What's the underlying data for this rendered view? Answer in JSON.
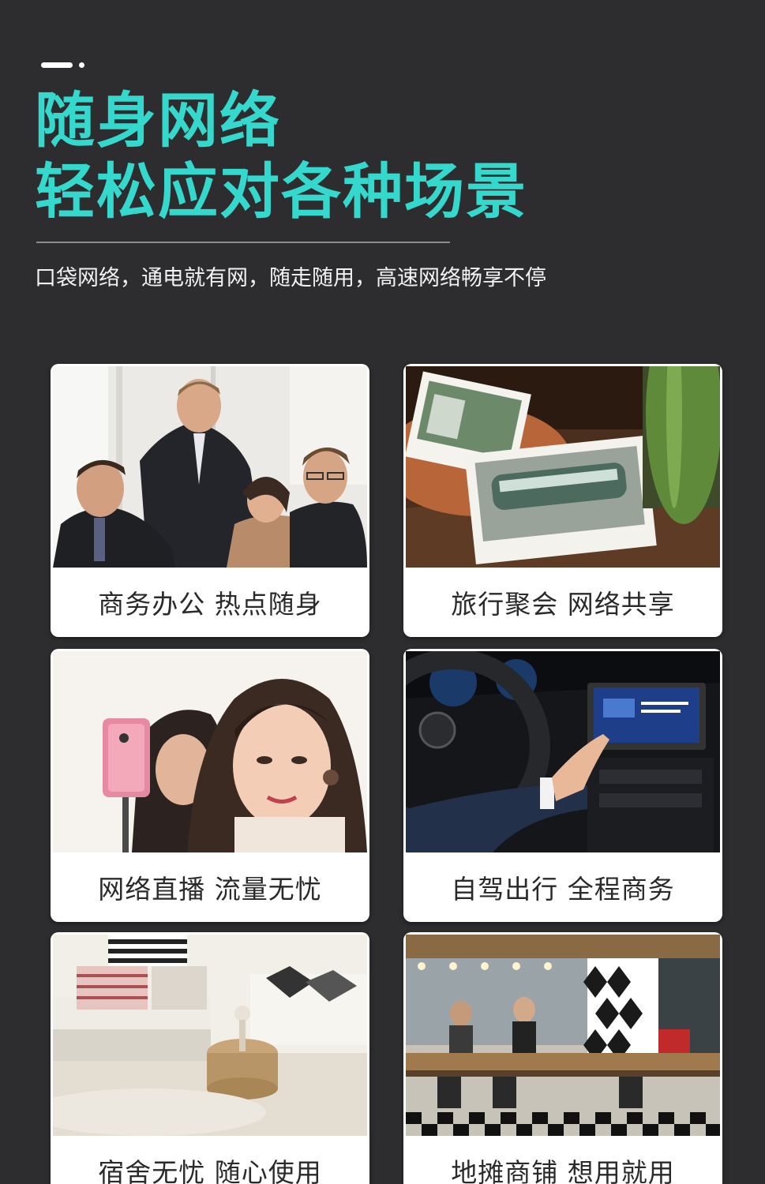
{
  "header": {
    "title_line1": "随身网络",
    "title_line2": "轻松应对各种场景",
    "subtitle": "口袋网络，通电就有网，随走随用，高速网络畅享不停",
    "accent_color": "#35d8cd",
    "background_color": "#2d2d2f"
  },
  "scenes": [
    {
      "caption": "商务办公  热点随身",
      "image": "business-meeting-photo"
    },
    {
      "caption": "旅行聚会  网络共享",
      "image": "travel-photos-photo"
    },
    {
      "caption": "网络直播  流量无忧",
      "image": "livestream-photo"
    },
    {
      "caption": "自驾出行 全程商务",
      "image": "car-dashboard-photo"
    },
    {
      "caption": "宿舍无忧  随心使用",
      "image": "dorm-room-photo"
    },
    {
      "caption": "地摊商铺  想用就用",
      "image": "shop-cafe-photo"
    }
  ]
}
